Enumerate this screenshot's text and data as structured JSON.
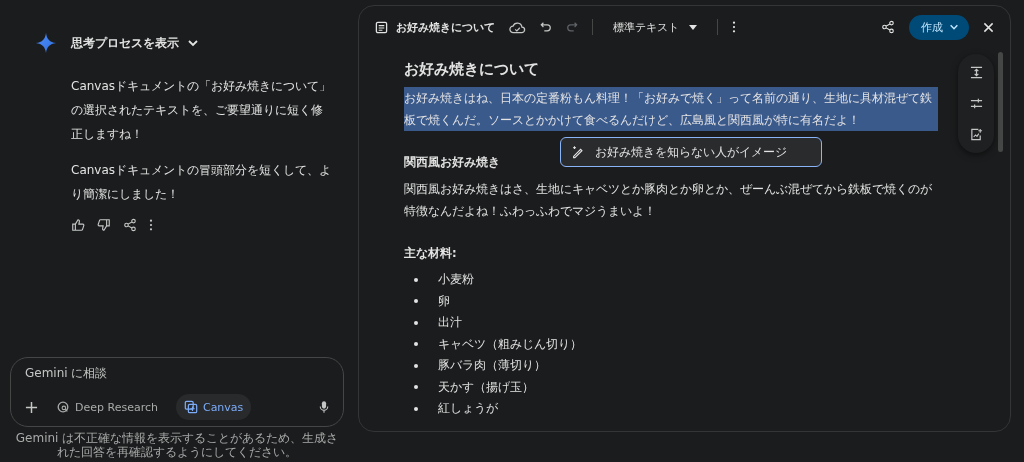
{
  "thinking_toggle": {
    "label": "思考プロセスを表示",
    "expanded": false
  },
  "response": {
    "paragraphs": [
      "Canvasドキュメントの「お好み焼きについて」の選択されたテキストを、ご要望通りに短く修正しますね！",
      "Canvasドキュメントの冒頭部分を短くして、より簡潔にしました！"
    ]
  },
  "prompt": {
    "placeholder": "Gemini に相談",
    "tools": [
      {
        "label": "Deep Research",
        "selected": false
      },
      {
        "label": "Canvas",
        "selected": true
      }
    ]
  },
  "disclaimer": "Gemini は不正確な情報を表示することがあるため、生成された回答を再確認するようにしてください。",
  "canvas": {
    "title": "お好み焼きについて",
    "style_dropdown": "標準テキスト",
    "create_button": "作成",
    "blocks": [
      {
        "kind": "heading",
        "text": "お好み焼きについて"
      },
      {
        "kind": "paragraph",
        "text": "お好み焼きはね、日本の定番粉もん料理！「お好みで焼く」って名前の通り、生地に具材混ぜて鉄板で焼くんだ。ソースとかかけて食べるんだけど、広島風と関西風が特に有名だよ！",
        "selected": true
      },
      {
        "kind": "subheading",
        "text": "関西風お好み焼き"
      },
      {
        "kind": "paragraph",
        "text": "関西風お好み焼きはさ、生地にキャベツとか豚肉とか卵とか、ぜーんぶ混ぜてから鉄板で焼くのが特徴なんだよね！ふわっふわでマジうまいよ！",
        "selected": false
      },
      {
        "kind": "subheading",
        "text": "主な材料:"
      },
      {
        "kind": "list",
        "items": [
          "小麦粉",
          "卵",
          "出汁",
          "キャベツ（粗みじん切り）",
          "豚バラ肉（薄切り）",
          "天かす（揚げ玉）",
          "紅しょうが"
        ]
      }
    ],
    "edit_popup": {
      "value": "お好み焼きを知らない人がイメージ"
    }
  }
}
